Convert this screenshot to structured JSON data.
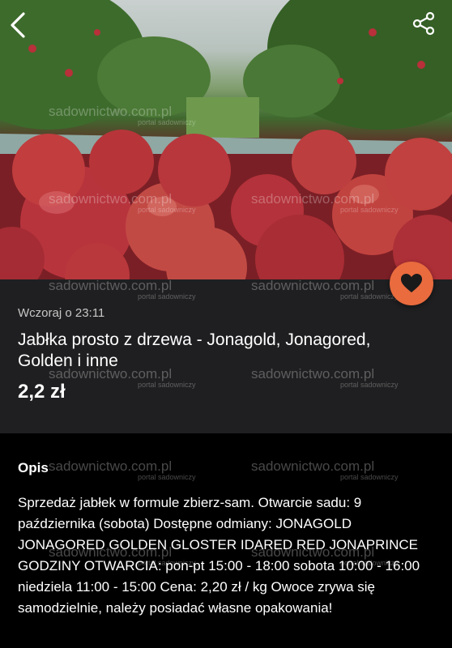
{
  "listing": {
    "posted": "Wczoraj o 23:11",
    "title": "Jabłka prosto z drzewa - Jonagold, Jonagored, Golden i inne",
    "price": "2,2 zł"
  },
  "description": {
    "heading": "Opis",
    "text": "Sprzedaż jabłek w formule zbierz-sam. Otwarcie sadu: 9 października (sobota) Dostępne odmiany: JONAGOLD JONAGORED GOLDEN GLOSTER IDARED RED JONAPRINCE GODZINY OTWARCIA: pon-pt 15:00 - 18:00 sobota 10:00 - 16:00 niedziela 11:00 - 15:00 Cena: 2,20 zł / kg Owoce zrywa się samodzielnie, należy posiadać własne opakowania!"
  },
  "watermark": {
    "site": "sadownictwo.com.pl",
    "tagline": "portal sadowniczy"
  },
  "icons": {
    "back": "chevron-left-icon",
    "share": "share-icon",
    "favorite": "heart-icon"
  },
  "colors": {
    "accent": "#e96b3e",
    "card_bg": "#1f1f21",
    "page_bg": "#000000"
  }
}
